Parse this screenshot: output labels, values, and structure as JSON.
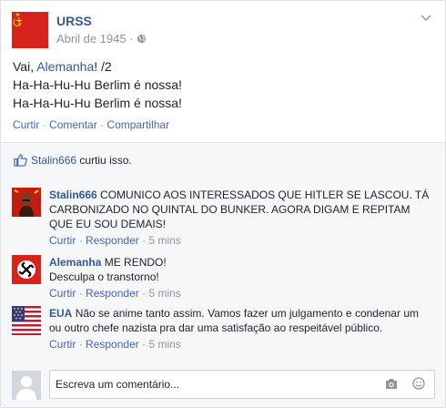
{
  "post": {
    "author": "URSS",
    "date": "Abril de 1945",
    "meta_sep": "·",
    "text_line1_prefix": "Vai, ",
    "text_line1_link": "Alemanha",
    "text_line1_suffix": "! /2",
    "text_line2": "Ha-Ha-Hu-Hu Berlim é nossa!",
    "text_line3": "Ha-Ha-Hu-Hu Berlim é nossa!",
    "actions": {
      "like": "Curtir",
      "comment": "Comentar",
      "share": "Compartilhar",
      "sep": "·"
    }
  },
  "likes": {
    "user": "Stalin666",
    "text": "curtiu isso."
  },
  "comments": [
    {
      "author": "Stalin666",
      "text": "COMUNICO AOS INTERESSADOS QUE HITLER SE LASCOU. TÁ CARBONIZADO NO QUINTAL DO BUNKER. AGORA DIGAM E REPITAM QUE EU SOU DEMAIS!",
      "like": "Curtir",
      "reply": "Responder",
      "time": "5 mins",
      "sep": "·"
    },
    {
      "author": "Alemanha",
      "text_line1": "ME RENDO!",
      "text_line2": "Desculpa o transtorno!",
      "like": "Curtir",
      "reply": "Responder",
      "time": "5 mins",
      "sep": "·"
    },
    {
      "author": "EUA",
      "text": "Não se anime tanto assim. Vamos fazer um julgamento e condenar um ou outro chefe nazista pra dar uma satisfação ao respeitável público.",
      "like": "Curtir",
      "reply": "Responder",
      "time": "5 mins",
      "sep": "·"
    }
  ],
  "composer": {
    "placeholder": "Escreva um comentário..."
  },
  "icons": [
    "hammer-sickle-icon",
    "globe-icon",
    "chevron-down-icon",
    "thumbs-up-icon",
    "swastika-icon",
    "us-flag-icon",
    "camera-icon",
    "smiley-icon",
    "default-avatar-icon"
  ],
  "colors": {
    "link": "#365899",
    "action": "#4267b2",
    "muted": "#90949c",
    "soviet_red": "#d8231d"
  }
}
